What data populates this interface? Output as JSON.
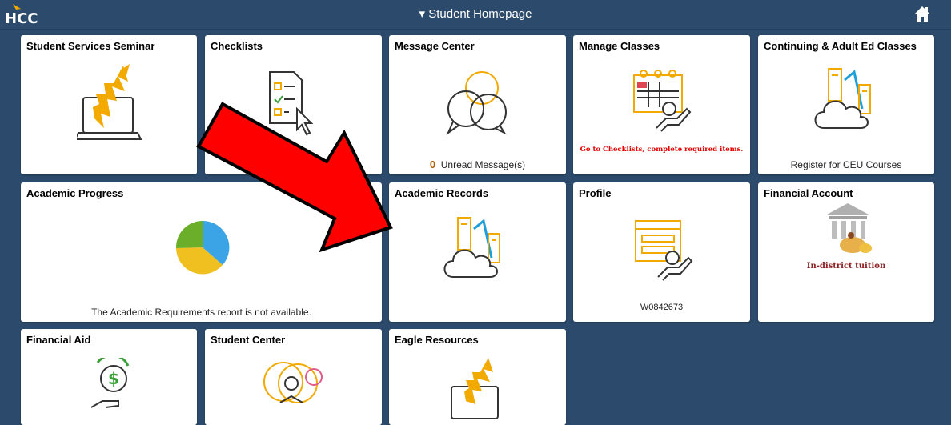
{
  "header": {
    "logo_text": "HCC",
    "title": "▾ Student Homepage",
    "home_icon": "home-icon"
  },
  "tiles": {
    "student_services_seminar": {
      "title": "Student Services Seminar",
      "icon": "eagle-laptop-icon"
    },
    "checklists": {
      "title": "Checklists",
      "icon": "checklist-cursor-icon"
    },
    "message_center": {
      "title": "Message Center",
      "icon": "chat-bubbles-icon",
      "count": "0",
      "footer": "Unread Message(s)"
    },
    "manage_classes": {
      "title": "Manage Classes",
      "icon": "calendar-person-icon",
      "note": "Go to Checklists, complete required items."
    },
    "continuing_ed": {
      "title": "Continuing & Adult Ed Classes",
      "icon": "cloud-buildings-icon",
      "footer": "Register for CEU Courses"
    },
    "academic_progress": {
      "title": "Academic Progress",
      "icon": "pie-chart-icon",
      "footer": "The Academic Requirements report is not available."
    },
    "academic_records": {
      "title": "Academic Records",
      "icon": "cloud-buildings-icon"
    },
    "profile": {
      "title": "Profile",
      "icon": "profile-form-icon",
      "footer": "W0842673"
    },
    "financial_account": {
      "title": "Financial Account",
      "icon": "bank-coins-icon",
      "note": "In-district tuition"
    },
    "financial_aid": {
      "title": "Financial Aid",
      "icon": "dollar-hand-icon"
    },
    "student_center": {
      "title": "Student Center",
      "icon": "student-reading-icon"
    },
    "eagle_resources": {
      "title": "Eagle Resources",
      "icon": "eagle-laptop-icon"
    }
  },
  "colors": {
    "background": "#2c4b6c",
    "accent_orange": "#f2a900",
    "annotation_arrow": "#ff0000"
  }
}
